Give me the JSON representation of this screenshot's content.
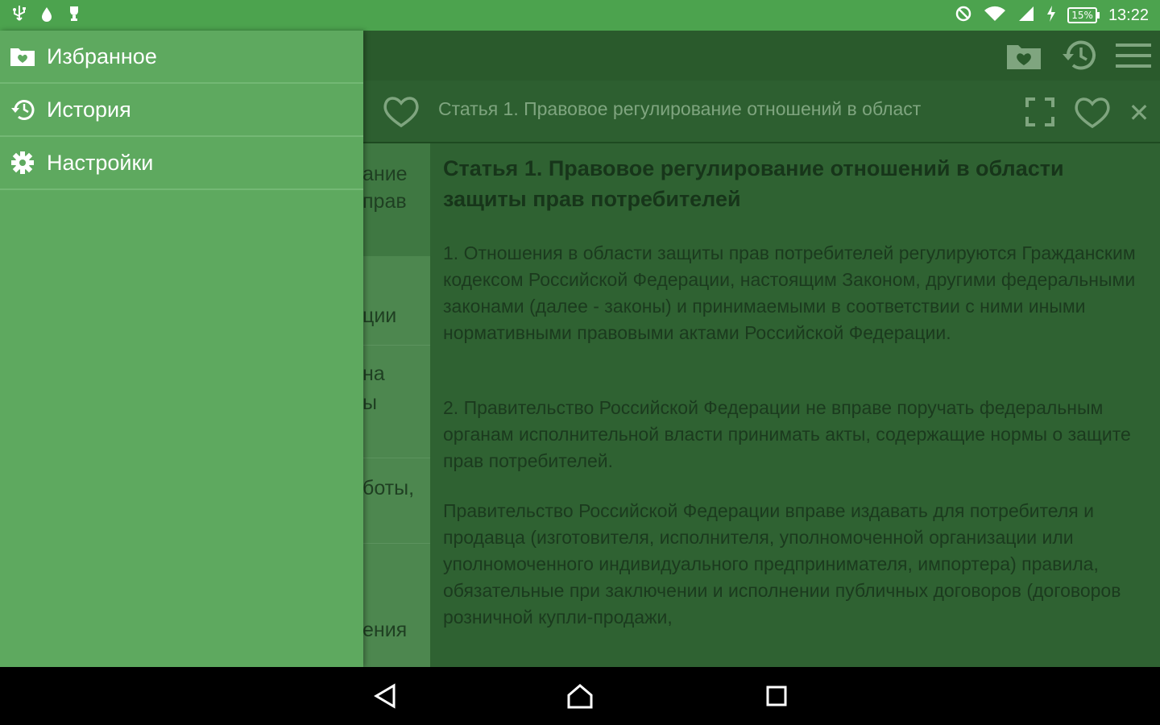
{
  "status_bar": {
    "time": "13:22",
    "battery": "15%"
  },
  "drawer": {
    "items": [
      {
        "label": "Избранное",
        "icon": "favorites-folder-icon"
      },
      {
        "label": "История",
        "icon": "history-icon"
      },
      {
        "label": "Настройки",
        "icon": "settings-gear-icon"
      }
    ]
  },
  "toolbar": {
    "actions": [
      "favorites-folder-icon",
      "history-icon",
      "menu-icon"
    ]
  },
  "tab": {
    "title": "Статья 1. Правовое регулирование отношений в област"
  },
  "toc": {
    "fragments": [
      "ание",
      "прав",
      "ции",
      "на",
      "ы",
      "боты,",
      "ения"
    ]
  },
  "article": {
    "title": "Статья 1. Правовое регулирование отношений в области защиты прав потребителей",
    "paragraphs": [
      "1. Отношения в области защиты прав потребителей регулируются Гражданским кодексом Российской Федерации, настоящим Законом, другими федеральными законами (далее - законы) и принимаемыми в соответствии с ними иными нормативными правовыми актами Российской Федерации.",
      "2. Правительство Российской Федерации не вправе поручать федеральным органам исполнительной власти принимать акты, содержащие нормы о защите прав потребителей.",
      "Правительство Российской Федерации вправе издавать для потребителя и продавца (изготовителя, исполнителя, уполномоченной организации или уполномоченного индивидуального предпринимателя, импортера) правила, обязательные при заключении и исполнении публичных договоров (договоров розничной купли-продажи,"
    ]
  },
  "colors": {
    "status_bar": "#4ca34e",
    "drawer": "#5ea95f",
    "toolbar": "#2a5a2c",
    "content_scrim": "#2f6232"
  }
}
